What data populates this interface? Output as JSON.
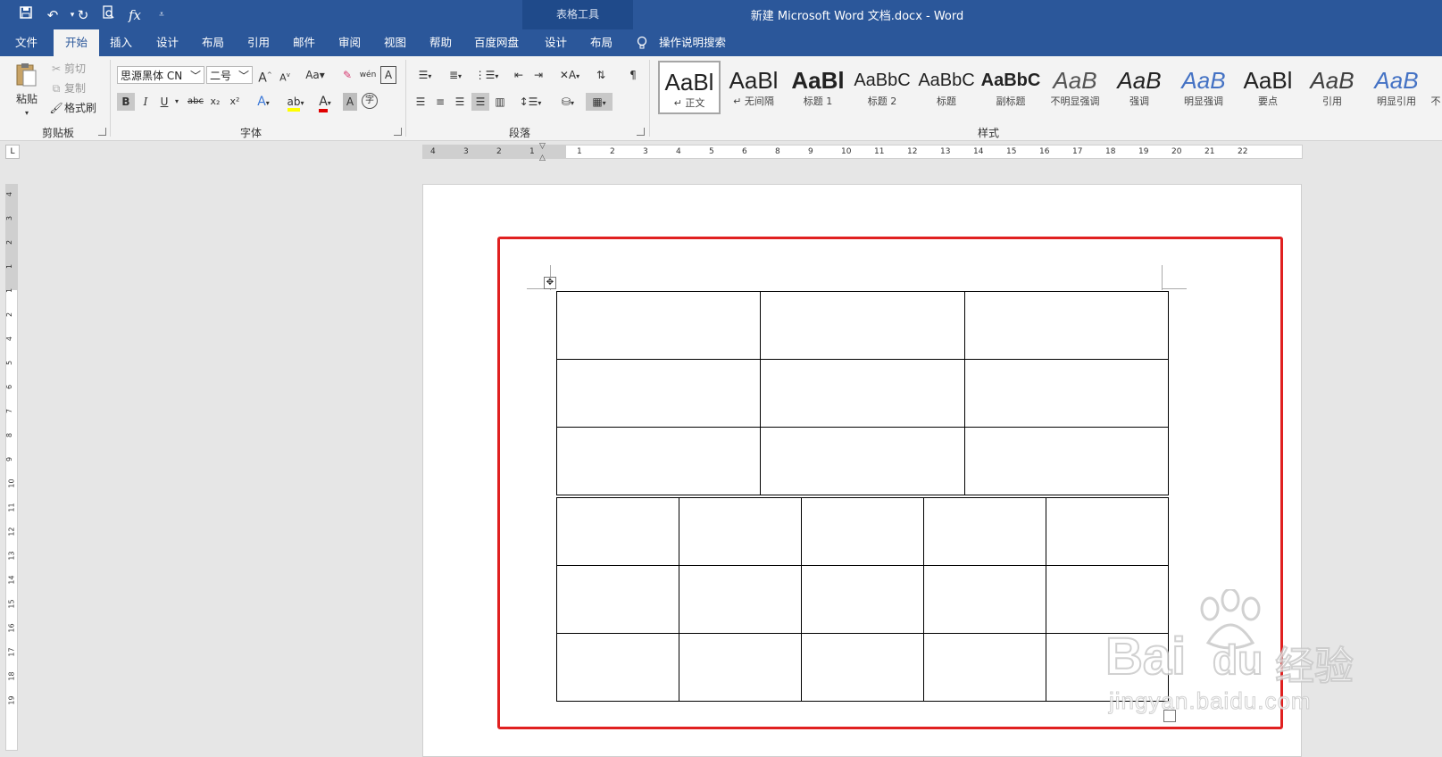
{
  "window": {
    "title": "新建 Microsoft Word 文档.docx  -  Word",
    "context_tab_group": "表格工具"
  },
  "tabs": [
    {
      "label": "文件"
    },
    {
      "label": "开始"
    },
    {
      "label": "插入"
    },
    {
      "label": "设计"
    },
    {
      "label": "布局"
    },
    {
      "label": "引用"
    },
    {
      "label": "邮件"
    },
    {
      "label": "审阅"
    },
    {
      "label": "视图"
    },
    {
      "label": "帮助"
    },
    {
      "label": "百度网盘"
    },
    {
      "label": "设计"
    },
    {
      "label": "布局"
    }
  ],
  "search": {
    "label": "操作说明搜索"
  },
  "clipboard": {
    "paste": "粘贴",
    "cut": "剪切",
    "copy": "复制",
    "format_painter": "格式刷",
    "group": "剪贴板"
  },
  "font": {
    "name": "思源黑体 CN",
    "size": "二号",
    "grow": "A",
    "shrink": "A",
    "case": "Aa",
    "bold": "B",
    "italic": "I",
    "underline": "U",
    "strike": "abc",
    "subscript": "x₂",
    "superscript": "x²",
    "effects": "A",
    "font_color": "A",
    "shading": "A",
    "phonetic": "wén",
    "border_char": "A",
    "enclose": "字",
    "group": "字体"
  },
  "paragraph": {
    "group": "段落"
  },
  "styles": {
    "group": "样式",
    "items": [
      {
        "sample": "AaBl",
        "name": "↵ 正文"
      },
      {
        "sample": "AaBl",
        "name": "↵ 无间隔"
      },
      {
        "sample": "AaBl",
        "name": "标题 1"
      },
      {
        "sample": "AaBbC",
        "name": "标题 2"
      },
      {
        "sample": "AaBbC",
        "name": "标题"
      },
      {
        "sample": "AaBbC",
        "name": "副标题"
      },
      {
        "sample": "AaB",
        "name": "不明显强调"
      },
      {
        "sample": "AaB",
        "name": "强调"
      },
      {
        "sample": "AaB",
        "name": "明显强调"
      },
      {
        "sample": "AaBl",
        "name": "要点"
      },
      {
        "sample": "AaB",
        "name": "引用"
      },
      {
        "sample": "AaB",
        "name": "明显引用"
      },
      {
        "sample": "",
        "name": "不"
      }
    ]
  },
  "ruler": {
    "left": [
      "4",
      "3",
      "2",
      "1"
    ],
    "right": [
      "1",
      "2",
      "3",
      "4",
      "5",
      "6",
      "8",
      "9",
      "10",
      "11",
      "12",
      "13",
      "14",
      "15",
      "16",
      "17",
      "18",
      "19",
      "20",
      "21",
      "22"
    ],
    "vertical": [
      "4",
      "3",
      "2",
      "1",
      "1",
      "2",
      "4",
      "5",
      "6",
      "7",
      "8",
      "9",
      "10",
      "11",
      "12",
      "13",
      "14",
      "15",
      "16",
      "17",
      "18",
      "19"
    ]
  },
  "table": {
    "top_rows": 3,
    "top_cols": 3,
    "bottom_rows": 3,
    "bottom_cols": 5
  },
  "watermark": {
    "brand": "Bai",
    "brand2": "du",
    "suffix": "经验",
    "url": "jingyan.baidu.com"
  },
  "colors": {
    "accent": "#2b579a",
    "highlight": "#e02020"
  }
}
